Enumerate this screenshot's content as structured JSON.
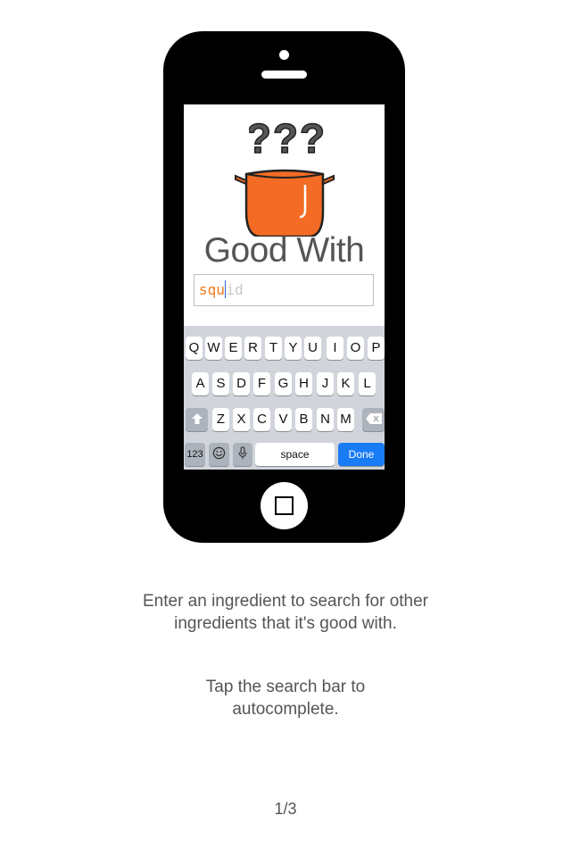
{
  "app": {
    "brand": "Good With",
    "question_marks": "???"
  },
  "search": {
    "typed": "squ",
    "suggestion": "id"
  },
  "keyboard": {
    "row1": [
      "Q",
      "W",
      "E",
      "R",
      "T",
      "Y",
      "U",
      "I",
      "O",
      "P"
    ],
    "row2": [
      "A",
      "S",
      "D",
      "F",
      "G",
      "H",
      "J",
      "K",
      "L"
    ],
    "row3": [
      "Z",
      "X",
      "C",
      "V",
      "B",
      "N",
      "M"
    ],
    "numbers_key": "123",
    "space_key": "space",
    "done_key": "Done"
  },
  "captions": {
    "line1a": "Enter an ingredient to search for other",
    "line1b": "ingredients that it's good with.",
    "line2a": "Tap the search bar to",
    "line2b": "autocomplete."
  },
  "pager": "1/3",
  "colors": {
    "accent": "#f36b24",
    "done_blue": "#1a7cf5",
    "keyboard_bg": "#d1d5db"
  },
  "icons": [
    "pot-icon",
    "shift-icon",
    "backspace-icon",
    "emoji-icon",
    "microphone-icon",
    "home-button-icon"
  ]
}
